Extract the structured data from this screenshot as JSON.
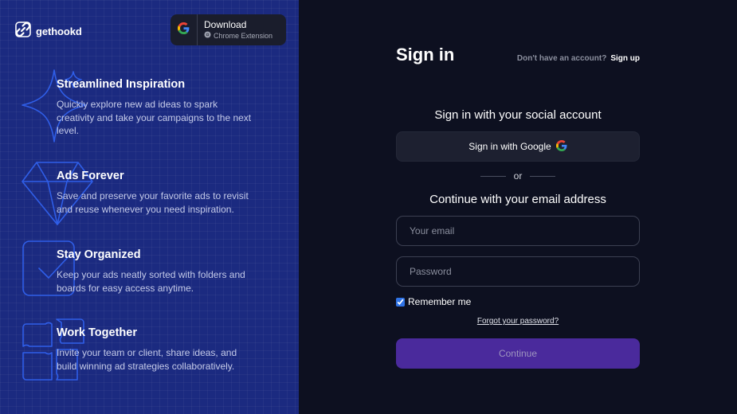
{
  "brand": {
    "name": "gethookd"
  },
  "download": {
    "title": "Download",
    "subtitle": "Chrome Extension"
  },
  "features": [
    {
      "title": "Streamlined Inspiration",
      "description": "Quickly explore new ad ideas to spark creativity and take your campaigns to the next level."
    },
    {
      "title": "Ads Forever",
      "description": "Save and preserve your favorite ads to revisit and reuse whenever you need inspiration."
    },
    {
      "title": "Stay Organized",
      "description": "Keep your ads neatly sorted with folders and boards for easy access anytime."
    },
    {
      "title": "Work Together",
      "description": "Invite your team or client, share ideas, and build winning ad strategies collaboratively."
    }
  ],
  "signin": {
    "title": "Sign in",
    "no_account": "Don't have an account?",
    "signup_link": "Sign up",
    "social_heading": "Sign in with your social account",
    "google_button": "Sign in with Google",
    "or": "or",
    "email_heading": "Continue with your email address",
    "email_placeholder": "Your email",
    "password_placeholder": "Password",
    "remember_label": "Remember me",
    "remember_checked": true,
    "forgot_link": "Forgot your password?",
    "continue_button": "Continue"
  },
  "colors": {
    "left_panel": "#1b2a80",
    "right_panel": "#0d1020",
    "continue_button": "#4a2a9c",
    "icon_outline": "#2f5ee8"
  },
  "icons": [
    "link-logo-icon",
    "google-icon",
    "chrome-icon",
    "sparkle-icon",
    "diamond-icon",
    "checkbox-icon",
    "puzzle-icon"
  ]
}
